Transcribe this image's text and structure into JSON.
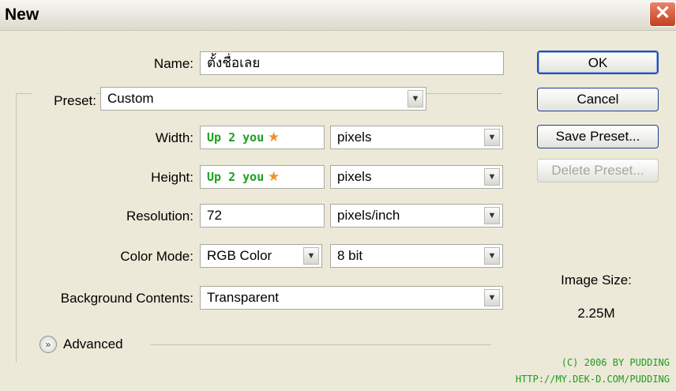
{
  "window": {
    "title": "New",
    "close_glyph": "✕"
  },
  "form": {
    "name_label": "Name:",
    "name_value": "ตั้งชื่อเลย",
    "preset_label": "Preset:",
    "preset_value": "Custom",
    "width_label": "Width:",
    "width_value": "Up 2 you",
    "width_unit": "pixels",
    "height_label": "Height:",
    "height_value": "Up 2 you",
    "height_unit": "pixels",
    "resolution_label": "Resolution:",
    "resolution_value": "72",
    "resolution_unit": "pixels/inch",
    "color_mode_label": "Color Mode:",
    "color_mode_value": "RGB Color",
    "bit_depth_value": "8 bit",
    "background_label": "Background Contents:",
    "background_value": "Transparent",
    "advanced_label": "Advanced",
    "star_glyph": "★"
  },
  "buttons": {
    "ok": "OK",
    "cancel": "Cancel",
    "save_preset": "Save Preset...",
    "delete_preset": "Delete Preset..."
  },
  "image_size": {
    "label": "Image Size:",
    "value": "2.25M"
  },
  "credits": {
    "line1": "(C) 2006 BY PUDDING",
    "line2": "HTTP://MY.DEK-D.COM/PUDDING"
  },
  "icons": {
    "dropdown": "chevron-down-icon",
    "advanced": "double-chevron-down-icon",
    "close": "close-icon"
  },
  "colors": {
    "accent_green": "#1fa01f",
    "star_orange": "#f0922a",
    "close_red": "#c3421c"
  }
}
